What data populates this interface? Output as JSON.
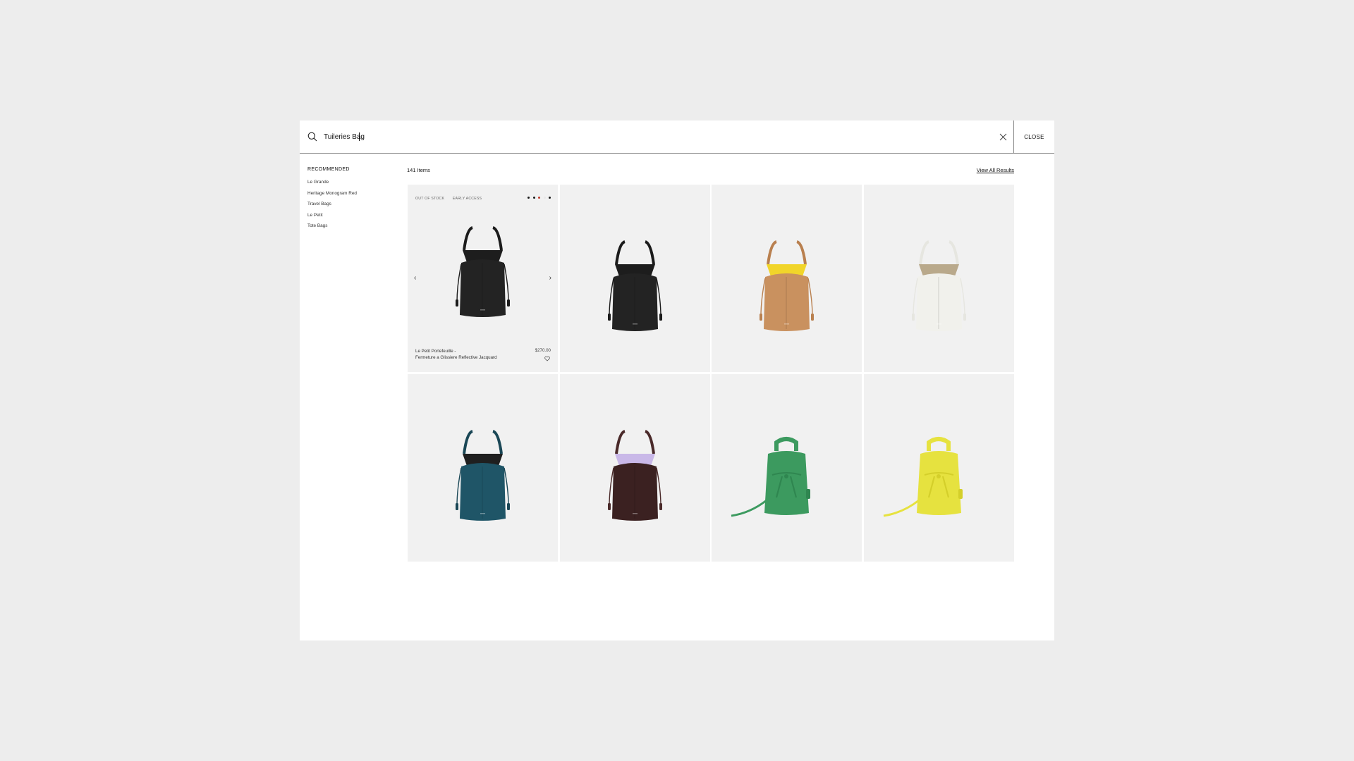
{
  "search": {
    "value": "Tuileries Bag",
    "close_label": "CLOSE"
  },
  "recommended": {
    "title": "RECOMMENDED",
    "items": [
      "Le Grande",
      "Heritage Monogram Red",
      "Travel Bags",
      "Le Petit",
      "Tote Bags"
    ]
  },
  "results": {
    "count_label": "141 Items",
    "view_all_label": "View All Results"
  },
  "featured": {
    "badges": [
      "OUT OF STOCK",
      "EARLY ACCESS"
    ],
    "swatches": [
      "#1a1a1a",
      "#1a1a1a",
      "#c0392b",
      "#e8e8e8",
      "#1a1a1a"
    ],
    "name_line1": "Le Petit Portefeuille -",
    "name_line2": "Fermeture a Glissiere Reflective Jacquard",
    "price": "$270.00",
    "prev_arrow": "‹",
    "next_arrow": "›"
  },
  "products": [
    {
      "style": "bucket",
      "body": "#232323",
      "lining": "#1d1d1d",
      "handle": "#1b1b1b"
    },
    {
      "style": "bucket",
      "body": "#232323",
      "lining": "#1d1d1d",
      "handle": "#1b1b1b"
    },
    {
      "style": "bucket",
      "body": "#c9915f",
      "lining": "#f1d52a",
      "handle": "#b9804f"
    },
    {
      "style": "bucket",
      "body": "#f1f1ec",
      "lining": "#b9a98b",
      "handle": "#e6e6e0"
    },
    {
      "style": "bucket",
      "body": "#1f5567",
      "lining": "#1f1f1f",
      "handle": "#1a4756"
    },
    {
      "style": "bucket",
      "body": "#3b2121",
      "lining": "#c9b8e8",
      "handle": "#4a2a2a"
    },
    {
      "style": "backpack",
      "body": "#3c9a5f",
      "lining": "#2f8650",
      "handle": "#3c9a5f"
    },
    {
      "style": "backpack",
      "body": "#e6e23f",
      "lining": "#d4cf2a",
      "handle": "#e6e23f"
    }
  ]
}
